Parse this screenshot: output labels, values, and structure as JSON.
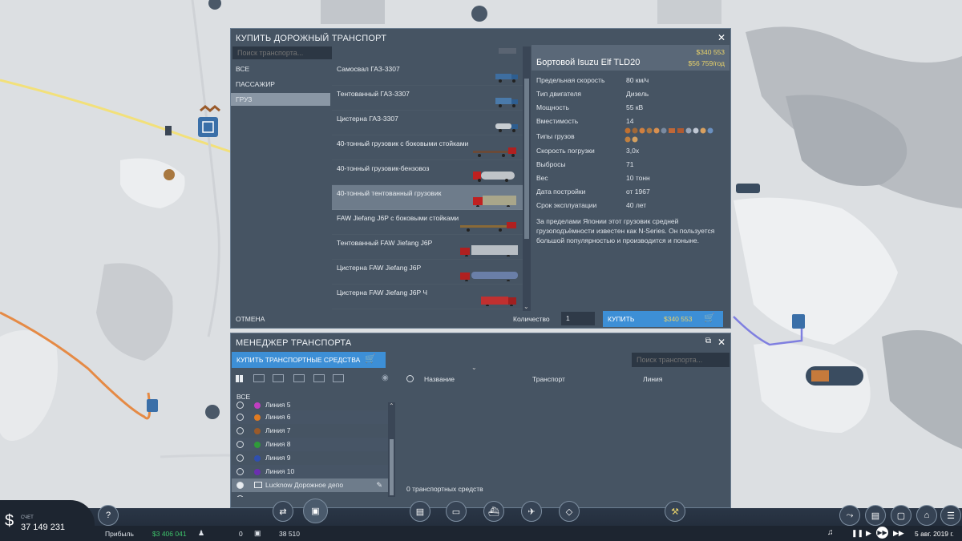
{
  "buy_dialog": {
    "title": "КУПИТЬ ДОРОЖНЫЙ ТРАНСПОРТ",
    "search_placeholder": "Поиск транспорта...",
    "categories": [
      "ВСЕ",
      "ПАССАЖИР",
      "ГРУЗ"
    ],
    "vehicles": [
      "Самосвал ГАЗ-3307",
      "Тентованный ГАЗ-3307",
      "Цистерна ГАЗ-3307",
      "40-тонный грузовик с боковыми стойками",
      "40-тонный грузовик-бензовоз",
      "40-тонный тентованный грузовик",
      "FAW Jiefang J6P с боковыми стойками",
      "Тентованный FAW Jiefang J6P",
      "Цистерна FAW Jiefang J6P",
      "Цистерна FAW Jiefang J6P Ч"
    ],
    "selected_vehicle_index": 5,
    "detail": {
      "name": "Бортовой Isuzu Elf TLD20",
      "price": "$340 553",
      "yearly": "$56 759/год",
      "specs": [
        {
          "label": "Предельная скорость",
          "value": "80 км/ч"
        },
        {
          "label": "Тип двигателя",
          "value": "Дизель"
        },
        {
          "label": "Мощность",
          "value": "55 кВ"
        },
        {
          "label": "Вместимость",
          "value": "14"
        },
        {
          "label": "Типы грузов",
          "value": ""
        },
        {
          "label": "Скорость погрузки",
          "value": "3,0x"
        },
        {
          "label": "Выбросы",
          "value": "71"
        },
        {
          "label": "Вес",
          "value": "10 тонн"
        },
        {
          "label": "Дата постройки",
          "value": "от 1967"
        },
        {
          "label": "Срок эксплуатации",
          "value": "40 лет"
        }
      ],
      "description": "За пределами Японии этот грузовик средней грузоподъёмности известен как N-Series. Он пользуется большой популярностью и производится и поныне."
    },
    "cancel_label": "ОТМЕНА",
    "quantity_label": "Количество",
    "quantity_value": "1",
    "buy_label": "КУПИТЬ",
    "buy_price": "$340 553"
  },
  "manager": {
    "title": "МЕНЕДЖЕР ТРАНСПОРТА",
    "buy_button": "КУПИТЬ ТРАНСПОРТНЫЕ СРЕДСТВА",
    "search_placeholder": "Поиск транспорта...",
    "all_label": "ВСЕ",
    "lines": [
      {
        "name": "Линия 5",
        "color": "#c03ec0"
      },
      {
        "name": "Линия 6",
        "color": "#e07b22"
      },
      {
        "name": "Линия 7",
        "color": "#9a5a2a"
      },
      {
        "name": "Линия 8",
        "color": "#2f9a3a"
      },
      {
        "name": "Линия 9",
        "color": "#2f4fb0"
      },
      {
        "name": "Линия 10",
        "color": "#6b2fb0"
      },
      {
        "name": "Lucknow Дорожное депо",
        "color": ""
      }
    ],
    "col_name": "Название",
    "col_vehicle": "Транспорт",
    "col_line": "Линия",
    "count_text": "0 транспортных средств"
  },
  "hud": {
    "account_label": "СЧЕТ",
    "account_value": "37 149 231",
    "profit_label": "Прибыль",
    "profit_value": "$3 406 041",
    "stat1": "0",
    "stat2": "38 510",
    "date": "5 авг. 2019 г."
  },
  "colors": {
    "accent": "#3d8fd6",
    "price": "#e8d26a",
    "panel": "#404e5e"
  }
}
